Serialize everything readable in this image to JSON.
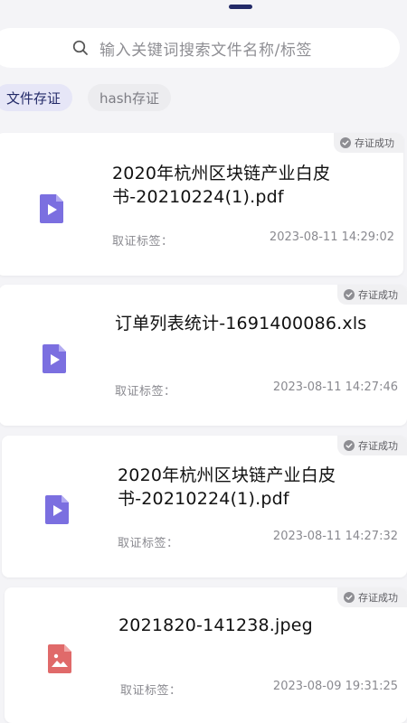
{
  "search": {
    "placeholder": "输入关键词搜索文件名称/标签"
  },
  "tabs": [
    {
      "label": "文件存证",
      "active": true
    },
    {
      "label": "hash存证",
      "active": false
    }
  ],
  "cards": [
    {
      "badge": "存证成功",
      "title_line1": "2020年杭州区块链产业白皮",
      "title_line2": "书-20210224(1).pdf",
      "label": "取证标签：",
      "time": "2023-08-11 14:29:02",
      "icon": "document-play-icon"
    },
    {
      "badge": "存证成功",
      "title_line1": "订单列表统计-1691400086.xls",
      "title_line2": "",
      "label": "取证标签：",
      "time": "2023-08-11 14:27:46",
      "icon": "document-play-icon"
    },
    {
      "badge": "存证成功",
      "title_line1": "2020年杭州区块链产业白皮",
      "title_line2": "书-20210224(1).pdf",
      "label": "取证标签：",
      "time": "2023-08-11 14:27:32",
      "icon": "document-play-icon"
    },
    {
      "badge": "存证成功",
      "title_line1": "2021820-141238.jpeg",
      "title_line2": "",
      "label": "取证标签：",
      "time": "2023-08-09 19:31:25",
      "icon": "image-file-icon"
    }
  ],
  "colors": {
    "accent": "#232a68",
    "doc_icon": "#7b6fe0",
    "image_icon": "#e06a6a"
  }
}
